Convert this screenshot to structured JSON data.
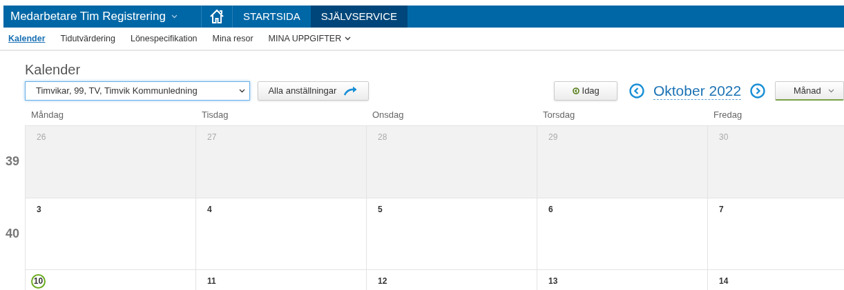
{
  "app_menu": {
    "title": "Medarbetare Tim Registrering"
  },
  "main_nav": [
    {
      "label": "STARTSIDA",
      "selected": false
    },
    {
      "label": "SJÄLVSERVICE",
      "selected": true
    }
  ],
  "sub_nav": [
    {
      "label": "Kalender",
      "selected": true,
      "kind": "link"
    },
    {
      "label": "Tidutvärdering",
      "selected": false,
      "kind": "link"
    },
    {
      "label": "Lönespecifikation",
      "selected": false,
      "kind": "link"
    },
    {
      "label": "Mina resor",
      "selected": false,
      "kind": "link"
    },
    {
      "label": "MINA UPPGIFTER",
      "selected": false,
      "kind": "dropdown"
    }
  ],
  "page_title": "Kalender",
  "employment_select": {
    "value": "Timvikar, 99, TV, Timvik Kommunledning"
  },
  "all_employments_button": "Alla anställningar",
  "today_button": "Idag",
  "month_title": "Oktober 2022",
  "view_select": {
    "value": "Månad"
  },
  "weekdays": [
    "Måndag",
    "Tisdag",
    "Onsdag",
    "Torsdag",
    "Fredag"
  ],
  "weeks": [
    {
      "number": "39",
      "days": [
        {
          "date": "26",
          "other_month": true,
          "today": false
        },
        {
          "date": "27",
          "other_month": true,
          "today": false
        },
        {
          "date": "28",
          "other_month": true,
          "today": false
        },
        {
          "date": "29",
          "other_month": true,
          "today": false
        },
        {
          "date": "30",
          "other_month": true,
          "today": false
        }
      ]
    },
    {
      "number": "40",
      "days": [
        {
          "date": "3",
          "other_month": false,
          "today": false
        },
        {
          "date": "4",
          "other_month": false,
          "today": false
        },
        {
          "date": "5",
          "other_month": false,
          "today": false
        },
        {
          "date": "6",
          "other_month": false,
          "today": false
        },
        {
          "date": "7",
          "other_month": false,
          "today": false
        }
      ]
    },
    {
      "days": [
        {
          "date": "10",
          "other_month": false,
          "today": true
        },
        {
          "date": "11",
          "other_month": false,
          "today": false
        },
        {
          "date": "12",
          "other_month": false,
          "today": false
        },
        {
          "date": "13",
          "other_month": false,
          "today": false
        },
        {
          "date": "14",
          "other_month": false,
          "today": false
        }
      ]
    }
  ]
}
